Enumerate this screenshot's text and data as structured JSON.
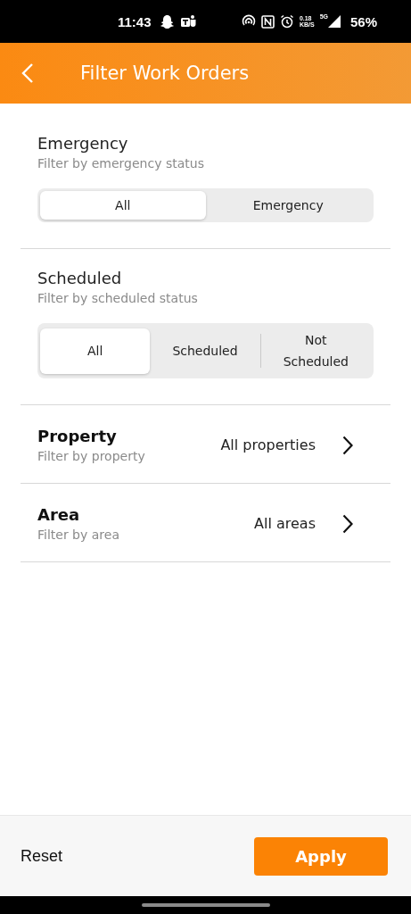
{
  "status_bar": {
    "time": "11:43",
    "net_speed": "0.18",
    "net_unit": "KB/S",
    "network": "5G",
    "battery": "56%"
  },
  "header": {
    "title": "Filter Work Orders"
  },
  "segment_filters": [
    {
      "title": "Emergency",
      "subtitle": "Filter by emergency status",
      "options": [
        {
          "label": "All",
          "selected": true
        },
        {
          "label": "Emergency",
          "selected": false
        }
      ]
    },
    {
      "title": "Scheduled",
      "subtitle": "Filter by scheduled status",
      "options": [
        {
          "label": "All",
          "selected": true
        },
        {
          "label": "Scheduled",
          "selected": false
        },
        {
          "label": "Not Scheduled",
          "selected": false
        }
      ]
    }
  ],
  "link_filters": [
    {
      "title": "Property",
      "subtitle": "Filter by property",
      "value": "All properties"
    },
    {
      "title": "Area",
      "subtitle": "Filter by area",
      "value": "All areas"
    }
  ],
  "footer": {
    "reset": "Reset",
    "apply": "Apply"
  }
}
